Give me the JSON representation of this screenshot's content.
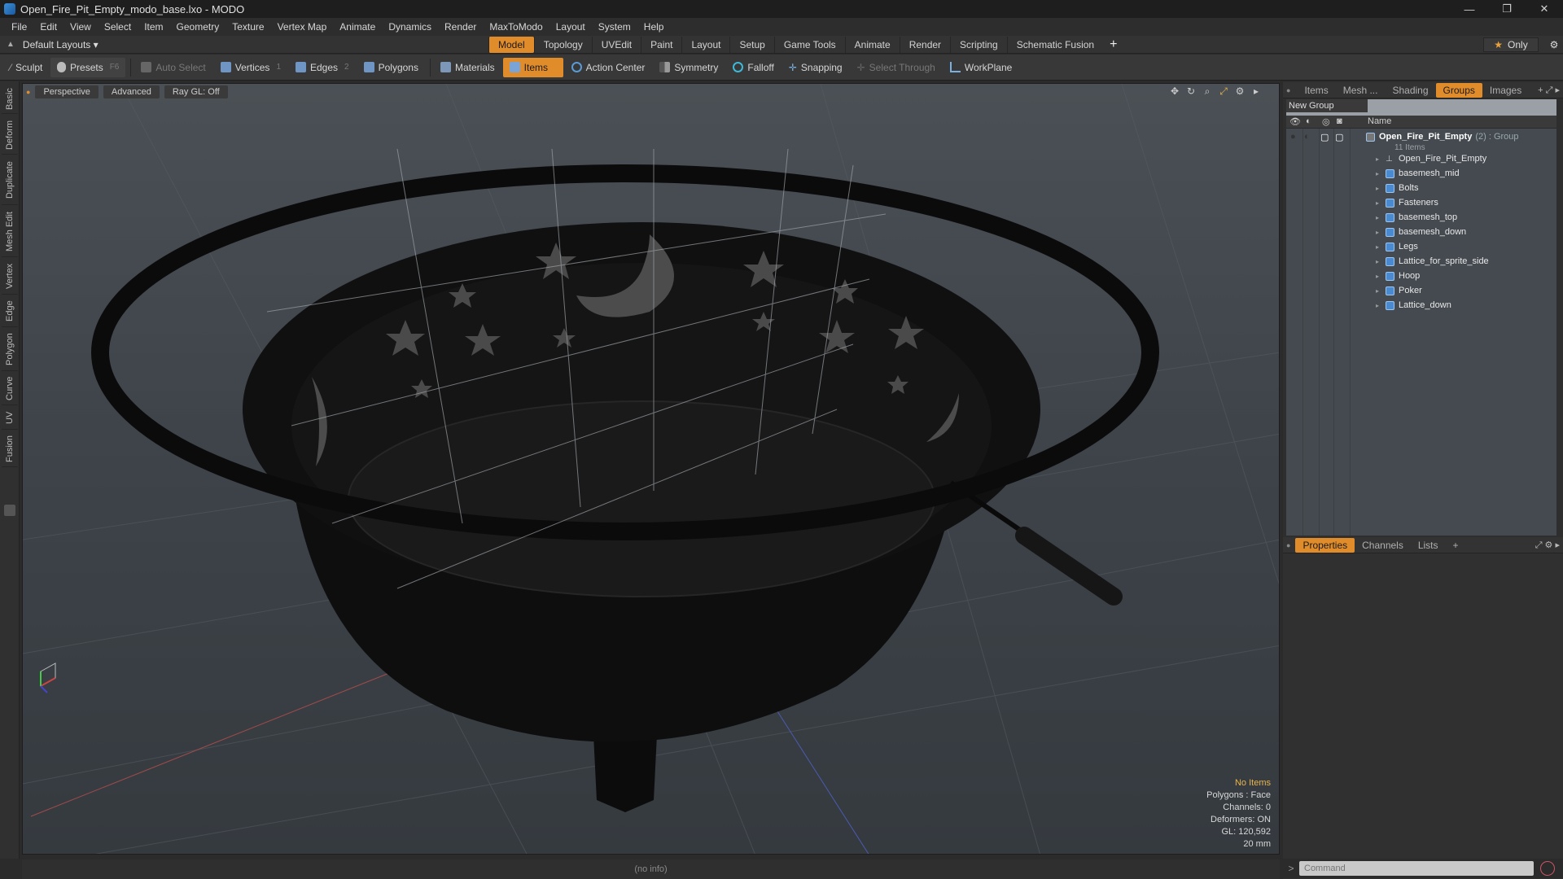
{
  "window": {
    "title": "Open_Fire_Pit_Empty_modo_base.lxo - MODO",
    "controls": [
      "—",
      "❐",
      "✕"
    ]
  },
  "menu": [
    "File",
    "Edit",
    "View",
    "Select",
    "Item",
    "Geometry",
    "Texture",
    "Vertex Map",
    "Animate",
    "Dynamics",
    "Render",
    "MaxToModo",
    "Layout",
    "System",
    "Help"
  ],
  "layout_bar": {
    "layout_name": "Default Layouts ▾",
    "tabs": [
      "Model",
      "Topology",
      "UVEdit",
      "Paint",
      "Layout",
      "Setup",
      "Game Tools",
      "Animate",
      "Render",
      "Scripting",
      "Schematic Fusion"
    ],
    "active_tab": "Model",
    "only_label": "Only"
  },
  "toolbar": {
    "sculpt": "Sculpt",
    "presets": "Presets",
    "presets_key": "F6",
    "auto_select": "Auto Select",
    "vertices": "Vertices",
    "vertices_count": "1",
    "edges": "Edges",
    "edges_count": "2",
    "polygons": "Polygons",
    "materials": "Materials",
    "items": "Items",
    "action_center": "Action Center",
    "symmetry": "Symmetry",
    "falloff": "Falloff",
    "snapping": "Snapping",
    "select_through": "Select Through",
    "workplane": "WorkPlane"
  },
  "left_tabs": [
    "Basic",
    "Deform",
    "Duplicate",
    "Mesh Edit",
    "Vertex",
    "Edge",
    "Polygon",
    "Curve",
    "UV",
    "Fusion"
  ],
  "viewport": {
    "view": "Perspective",
    "shading": "Advanced",
    "raygl": "Ray GL: Off",
    "info": {
      "selection": "No Items",
      "polygons": "Polygons : Face",
      "channels": "Channels: 0",
      "deformers": "Deformers: ON",
      "gl": "GL: 120,592",
      "unit": "20 mm"
    }
  },
  "status_bar": "(no info)",
  "groups_panel": {
    "tabs": [
      "Items",
      "Mesh ...",
      "Shading",
      "Groups",
      "Images"
    ],
    "active_tab": "Groups",
    "new_group": "New Group",
    "col_name": "Name",
    "group": {
      "name": "Open_Fire_Pit_Empty",
      "suffix": "(2) : Group",
      "count": "11 Items"
    },
    "items": [
      {
        "name": "Open_Fire_Pit_Empty",
        "type": "locator"
      },
      {
        "name": "basemesh_mid",
        "type": "mesh"
      },
      {
        "name": "Bolts",
        "type": "mesh"
      },
      {
        "name": "Fasteners",
        "type": "mesh"
      },
      {
        "name": "basemesh_top",
        "type": "mesh"
      },
      {
        "name": "basemesh_down",
        "type": "mesh"
      },
      {
        "name": "Legs",
        "type": "mesh"
      },
      {
        "name": "Lattice_for_sprite_side",
        "type": "mesh"
      },
      {
        "name": "Hoop",
        "type": "mesh"
      },
      {
        "name": "Poker",
        "type": "mesh"
      },
      {
        "name": "Lattice_down",
        "type": "mesh"
      }
    ]
  },
  "properties_panel": {
    "tabs": [
      "Properties",
      "Channels",
      "Lists"
    ],
    "active_tab": "Properties"
  },
  "command": {
    "prompt": ">",
    "placeholder": "Command"
  },
  "colors": {
    "accent": "#e08c2b",
    "viewport_bg": "#3e444a",
    "mesh_icon": "#4a8ad0"
  }
}
